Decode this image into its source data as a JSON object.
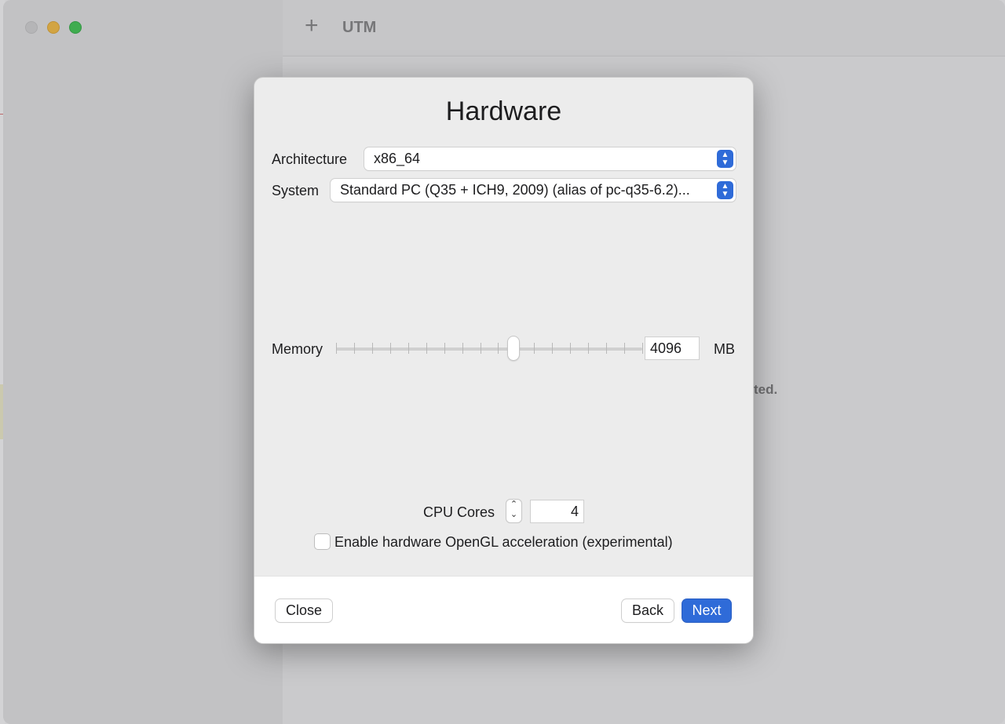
{
  "app": {
    "title": "UTM",
    "add_icon": "plus-icon",
    "background_text": "ted."
  },
  "sheet": {
    "title": "Hardware",
    "architecture": {
      "label": "Architecture",
      "value": "x86_64"
    },
    "system": {
      "label": "System",
      "value": "Standard PC (Q35 + ICH9, 2009) (alias of pc-q35-6.2)..."
    },
    "memory": {
      "label": "Memory",
      "value": "4096",
      "unit": "MB",
      "slider_fraction": 0.58
    },
    "cpu": {
      "label": "CPU Cores",
      "value": "4"
    },
    "opengl": {
      "label": "Enable hardware OpenGL acceleration (experimental)",
      "checked": false
    }
  },
  "footer": {
    "close_label": "Close",
    "back_label": "Back",
    "next_label": "Next"
  },
  "colors": {
    "accent": "#2f6bd8",
    "traffic_yellow": "#febc2e",
    "traffic_green": "#2bc840"
  }
}
